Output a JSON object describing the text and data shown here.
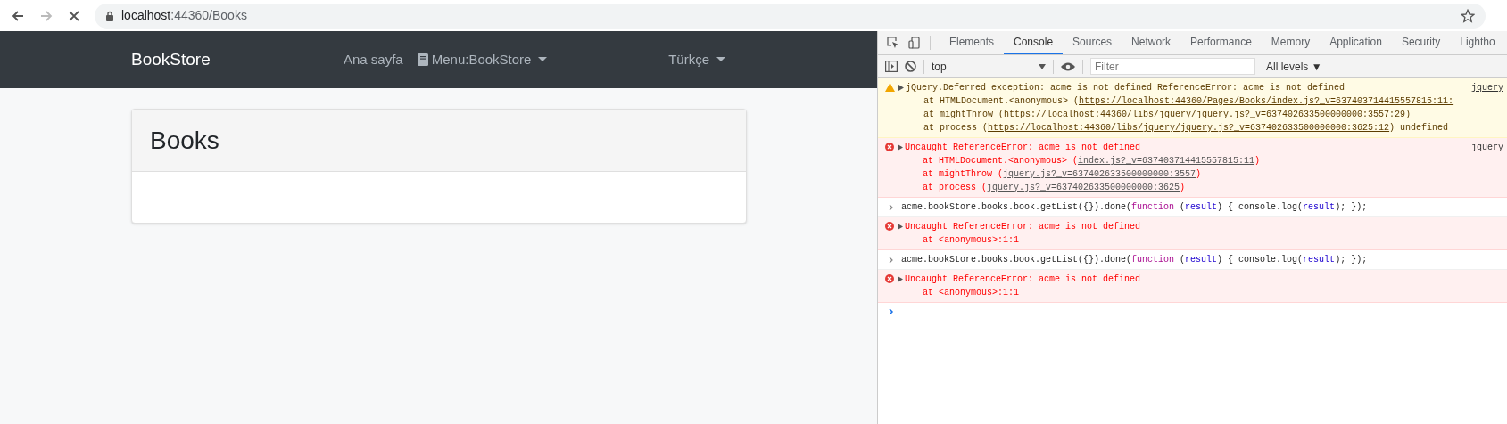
{
  "browser": {
    "back_disabled": false,
    "forward_disabled": true,
    "url_host": "localhost",
    "url_path": ":44360/Books"
  },
  "navbar": {
    "brand": "BookStore",
    "items": [
      {
        "label": "Ana sayfa",
        "kind": "link"
      },
      {
        "label": "Menu:BookStore",
        "kind": "dropdown"
      }
    ],
    "language": "Türkçe"
  },
  "card": {
    "title": "Books"
  },
  "devtools": {
    "tabs": [
      {
        "label": "Elements",
        "selected": false
      },
      {
        "label": "Console",
        "selected": true
      },
      {
        "label": "Sources",
        "selected": false
      },
      {
        "label": "Network",
        "selected": false
      },
      {
        "label": "Performance",
        "selected": false
      },
      {
        "label": "Memory",
        "selected": false
      },
      {
        "label": "Application",
        "selected": false
      },
      {
        "label": "Security",
        "selected": false
      },
      {
        "label": "Lightho",
        "selected": false
      }
    ],
    "context": "top",
    "filter_placeholder": "Filter",
    "levels": "All levels ▼",
    "messages": [
      {
        "kind": "warning",
        "text": "jQuery.Deferred exception: acme is not defined ReferenceError: acme is not defined",
        "source": "jquery",
        "stack": [
          {
            "at": "at HTMLDocument.<anonymous> (",
            "link": "https://localhost:44360/Pages/Books/index.js?_v=637403714415557815:11:"
          },
          {
            "at": "at mightThrow (",
            "link": "https://localhost:44360/libs/jquery/jquery.js?_v=637402633500000000:3557:29",
            "end": ")"
          },
          {
            "at": "at process (",
            "link": "https://localhost:44360/libs/jquery/jquery.js?_v=637402633500000000:3625:12",
            "end": ") undefined"
          }
        ]
      },
      {
        "kind": "error",
        "text": "Uncaught ReferenceError: acme is not defined",
        "source": "jquery",
        "stack": [
          {
            "at": "at HTMLDocument.<anonymous> (",
            "link": "index.js?_v=637403714415557815:11",
            "end": ")"
          },
          {
            "at": "at mightThrow (",
            "link": "jquery.js?_v=637402633500000000:3557",
            "end": ")"
          },
          {
            "at": "at process (",
            "link": "jquery.js?_v=637402633500000000:3625",
            "end": ")"
          }
        ]
      },
      {
        "kind": "input",
        "tokens": [
          {
            "t": "acme.bookStore.books.book.getList({}).done(",
            "kind": "plain"
          },
          {
            "t": "function",
            "kind": "keyword"
          },
          {
            "t": " (",
            "kind": "plain"
          },
          {
            "t": "result",
            "kind": "param"
          },
          {
            "t": ") { console.log(",
            "kind": "plain"
          },
          {
            "t": "result",
            "kind": "param"
          },
          {
            "t": "); });",
            "kind": "plain"
          }
        ]
      },
      {
        "kind": "error",
        "text": "Uncaught ReferenceError: acme is not defined",
        "stack": [
          {
            "at": "at <anonymous>:1:1"
          }
        ]
      },
      {
        "kind": "input",
        "tokens": [
          {
            "t": "acme.bookStore.books.book.getList({}).done(",
            "kind": "plain"
          },
          {
            "t": "function",
            "kind": "keyword"
          },
          {
            "t": " (",
            "kind": "plain"
          },
          {
            "t": "result",
            "kind": "param"
          },
          {
            "t": ") { console.log(",
            "kind": "plain"
          },
          {
            "t": "result",
            "kind": "param"
          },
          {
            "t": "); });",
            "kind": "plain"
          }
        ]
      },
      {
        "kind": "error",
        "text": "Uncaught ReferenceError: acme is not defined",
        "stack": [
          {
            "at": "at <anonymous>:1:1"
          }
        ]
      },
      {
        "kind": "prompt"
      }
    ]
  }
}
